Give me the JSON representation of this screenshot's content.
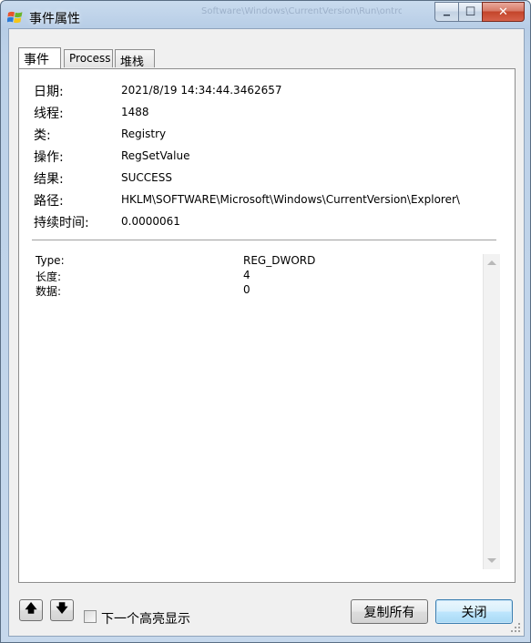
{
  "window": {
    "title": "事件属性",
    "ghost_text": "Software\\Windows\\CurrentVersion\\Run\\ontrolsys"
  },
  "caption_buttons": {
    "minimize": "▁",
    "maximize": "☐",
    "close": "✕"
  },
  "tabs": [
    {
      "label": "事件",
      "active": true
    },
    {
      "label": "Process",
      "active": false
    },
    {
      "label": "堆栈",
      "active": false
    }
  ],
  "properties": [
    {
      "label": "日期:",
      "value": "2021/8/19 14:34:44.3462657"
    },
    {
      "label": "线程:",
      "value": "1488"
    },
    {
      "label": "类:",
      "value": "Registry"
    },
    {
      "label": "操作:",
      "value": "RegSetValue"
    },
    {
      "label": "结果:",
      "value": "SUCCESS"
    },
    {
      "label": "路径:",
      "value": "HKLM\\SOFTWARE\\Microsoft\\Windows\\CurrentVersion\\Explorer\\"
    },
    {
      "label": "持续时间:",
      "value": "0.0000061"
    }
  ],
  "details": [
    {
      "label": "Type:",
      "value": "REG_DWORD"
    },
    {
      "label": "长度:",
      "value": "4"
    },
    {
      "label": "数据:",
      "value": "0"
    }
  ],
  "footer": {
    "up_glyph": "🡅",
    "down_glyph": "🡇",
    "highlight_next_label": "下一个高亮显示",
    "highlight_next_checked": false,
    "copy_all_label": "复制所有",
    "close_label": "关闭"
  },
  "icons": {
    "app": "windows-flag-icon",
    "up": "arrow-up-icon",
    "down": "arrow-down-icon",
    "grip": "resize-grip-icon"
  }
}
